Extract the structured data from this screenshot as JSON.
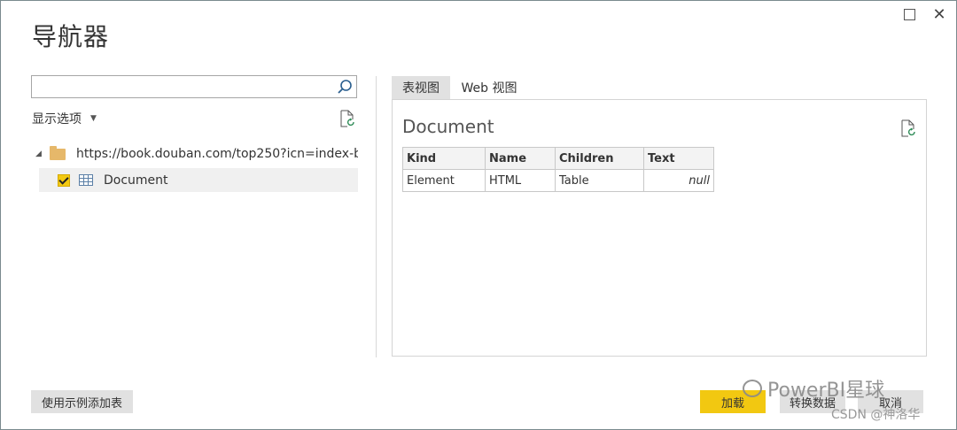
{
  "window": {
    "title": "导航器"
  },
  "left": {
    "search": {
      "value": "",
      "placeholder": ""
    },
    "display_options": "显示选项",
    "tree": {
      "root": "https://book.douban.com/top250?icn=index-b...",
      "items": [
        {
          "label": "Document",
          "checked": true
        }
      ]
    }
  },
  "tabs": [
    {
      "label": "表视图",
      "active": true
    },
    {
      "label": "Web 视图",
      "active": false
    }
  ],
  "preview": {
    "title": "Document",
    "table": {
      "headers": [
        "Kind",
        "Name",
        "Children",
        "Text"
      ],
      "rows": [
        [
          "Element",
          "HTML",
          "Table",
          "null"
        ]
      ]
    }
  },
  "buttons": {
    "add_from_examples": "使用示例添加表",
    "load": "加载",
    "transform": "转换数据",
    "cancel": "取消"
  },
  "watermark": {
    "line1": "PowerBI星球",
    "line2": "CSDN @神洛华"
  },
  "colors": {
    "accent": "#f2c811",
    "folder": "#e6b86a"
  }
}
